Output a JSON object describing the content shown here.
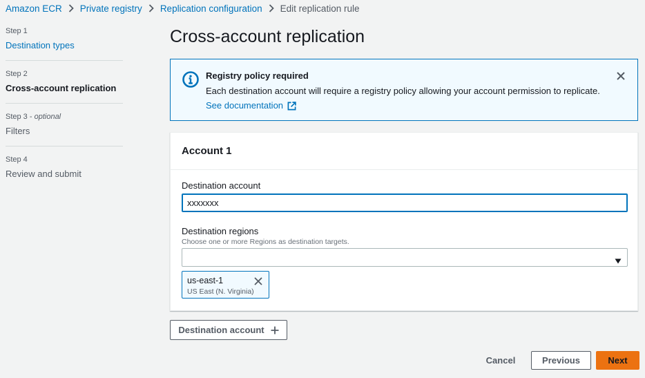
{
  "breadcrumb": {
    "items": [
      "Amazon ECR",
      "Private registry",
      "Replication configuration"
    ],
    "current": "Edit replication rule"
  },
  "steps": [
    {
      "number": "Step 1",
      "optional": "",
      "title": "Destination types",
      "state": "link"
    },
    {
      "number": "Step 2",
      "optional": "",
      "title": "Cross-account replication",
      "state": "current"
    },
    {
      "number": "Step 3",
      "optional": "optional",
      "title": "Filters",
      "state": "disabled"
    },
    {
      "number": "Step 4",
      "optional": "",
      "title": "Review and submit",
      "state": "disabled"
    }
  ],
  "page": {
    "title": "Cross-account replication"
  },
  "alert": {
    "title": "Registry policy required",
    "body": "Each destination account will require a registry policy allowing your account permission to replicate.",
    "link": "See documentation",
    "icon": "info-icon"
  },
  "account": {
    "title": "Account 1",
    "destination_account_label": "Destination account",
    "destination_account_value": "xxxxxxx",
    "regions_label": "Destination regions",
    "regions_description": "Choose one or more Regions as destination targets.",
    "selected_regions": [
      {
        "label": "us-east-1",
        "description": "US East (N. Virginia)"
      }
    ]
  },
  "actions": {
    "add_destination": "Destination account",
    "cancel": "Cancel",
    "previous": "Previous",
    "next": "Next"
  },
  "colors": {
    "link": "#0073bb",
    "primary": "#ec7211",
    "info_bg": "#f1faff",
    "page_bg": "#f2f3f3"
  }
}
